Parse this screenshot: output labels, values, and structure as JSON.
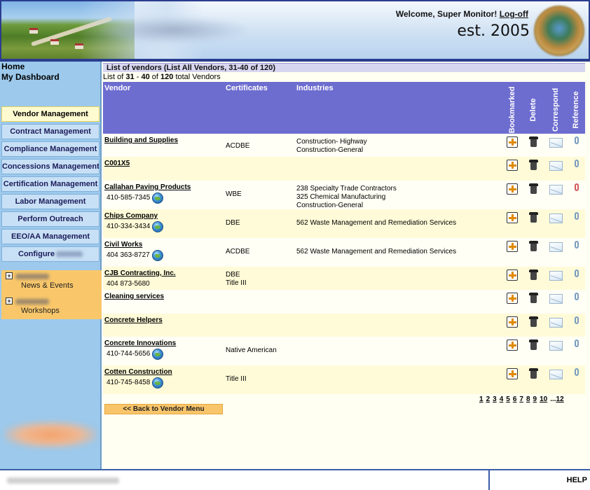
{
  "header": {
    "welcome_text": "Welcome, Super Monitor!",
    "logoff_label": "Log-off",
    "est_text": "est. 2005"
  },
  "sidebar": {
    "home_label": "Home",
    "dashboard_label": "My Dashboard",
    "menu": [
      {
        "label": "Vendor Management",
        "active": true
      },
      {
        "label": "Contract Management"
      },
      {
        "label": "Compliance Management"
      },
      {
        "label": "Concessions Management"
      },
      {
        "label": "Certification Management"
      },
      {
        "label": "Labor Management"
      },
      {
        "label": "Perform Outreach"
      },
      {
        "label": "EEO/AA Management"
      },
      {
        "label": "Configure"
      }
    ],
    "ribbon": [
      {
        "label": "News & Events"
      },
      {
        "label": "Workshops"
      }
    ]
  },
  "main": {
    "title": "List of vendors (List All Vendors, 31-40 of 120)",
    "subtitle_prefix": "List of",
    "range_start": "31",
    "range_sep": "-",
    "range_end": "40",
    "of_label": "of",
    "total": "120",
    "total_suffix": "total Vendors",
    "columns": {
      "vendor": "Vendor",
      "certificates": "Certificates",
      "industries": "Industries",
      "bookmarked": "Bookmarked",
      "delete": "Delete",
      "correspond": "Correspond",
      "reference": "Reference"
    },
    "rows": [
      {
        "name": "Building and Supplies",
        "phone": "",
        "cert": "ACDBE",
        "industries": [
          "Construction- Highway",
          "Construction-General"
        ]
      },
      {
        "name": "C001X5",
        "phone": "",
        "cert": "",
        "industries": []
      },
      {
        "name": "Callahan Paving Products",
        "phone": "410-585-7345",
        "cert": "WBE",
        "industries": [
          "238 Specialty Trade Contractors",
          "325 Chemical Manufacturing",
          "Construction-General"
        ]
      },
      {
        "name": "Chips Company",
        "phone": "410-334-3434",
        "cert": "DBE",
        "industries": [
          "562 Waste Management and Remediation Services"
        ]
      },
      {
        "name": "Civil Works",
        "phone": "404 363-8727",
        "cert": "ACDBE",
        "industries": [
          "562 Waste Management and Remediation Services"
        ]
      },
      {
        "name": "CJB Contracting, Inc.",
        "phone": "404 873-5680",
        "cert": "DBE\nTitle III",
        "industries": []
      },
      {
        "name": "Cleaning services",
        "phone": "",
        "cert": "",
        "industries": []
      },
      {
        "name": "Concrete Helpers",
        "phone": "",
        "cert": "",
        "industries": []
      },
      {
        "name": "Concrete Innovations",
        "phone": "410-744-5656",
        "cert": "Native American",
        "industries": []
      },
      {
        "name": "Cotten Construction",
        "phone": "410-745-8458",
        "cert": "Title III",
        "industries": []
      }
    ],
    "pager": [
      "1",
      "2",
      "3",
      "4",
      "5",
      "6",
      "7",
      "8",
      "9",
      "10",
      "...",
      "12"
    ],
    "back_label": "<< Back to Vendor Menu"
  },
  "footer": {
    "help_label": "HELP"
  }
}
